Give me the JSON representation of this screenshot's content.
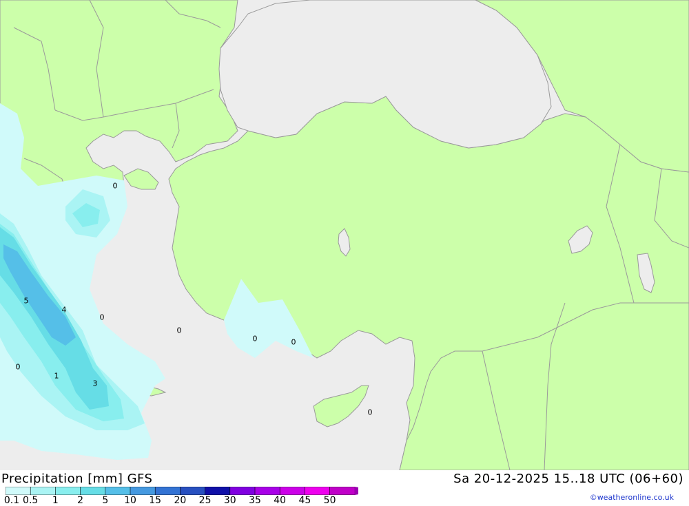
{
  "map": {
    "colors": {
      "sea": "#ededed",
      "land": "#ccffaa",
      "border": "#9a9a9a"
    },
    "precip_labels": [
      "0",
      "5",
      "4",
      "0",
      "0",
      "0",
      "0",
      "0",
      "1",
      "3",
      "0"
    ]
  },
  "footer": {
    "title": "Precipitation [mm] GFS",
    "time": "Sa 20-12-2025 15..18 UTC (06+60)",
    "credit": "©weatheronline.co.uk"
  },
  "legend": {
    "labels": [
      "0.1",
      "0.5",
      "1",
      "2",
      "5",
      "10",
      "15",
      "20",
      "25",
      "30",
      "35",
      "40",
      "45",
      "50"
    ],
    "colors": [
      "#d0fafa",
      "#aaf4f4",
      "#88eeee",
      "#66dde6",
      "#55bfe8",
      "#4599e0",
      "#3373d4",
      "#2850c0",
      "#1010a8",
      "#8000e0",
      "#a800e8",
      "#cc00e8",
      "#ee00ee",
      "#c000c8",
      "#9a00b0"
    ]
  }
}
